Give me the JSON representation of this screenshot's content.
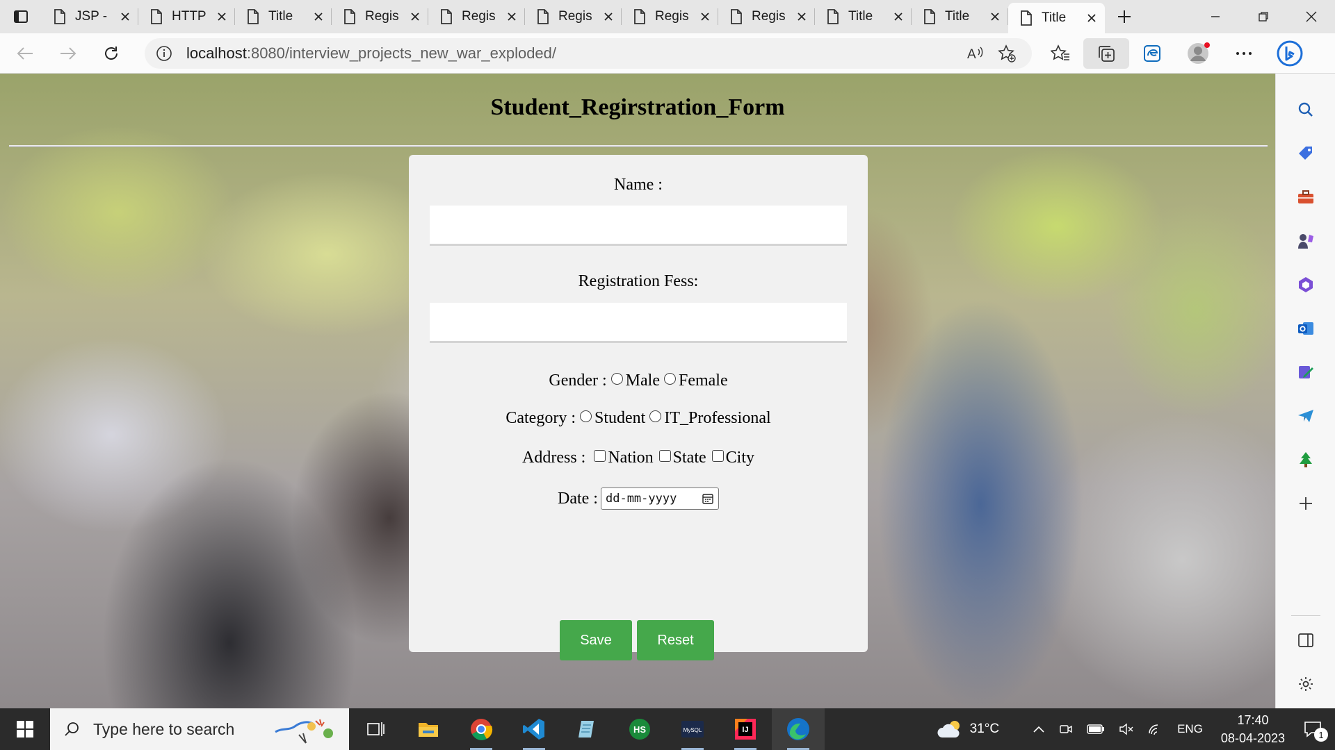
{
  "browser": {
    "tabs": [
      {
        "label": "JSP -",
        "active": false
      },
      {
        "label": "HTTP",
        "active": false
      },
      {
        "label": "Title",
        "active": false
      },
      {
        "label": "Regis",
        "active": false
      },
      {
        "label": "Regis",
        "active": false
      },
      {
        "label": "Regis",
        "active": false
      },
      {
        "label": "Regis",
        "active": false
      },
      {
        "label": "Regis",
        "active": false
      },
      {
        "label": "Title",
        "active": false
      },
      {
        "label": "Title",
        "active": false
      },
      {
        "label": "Title",
        "active": true
      }
    ],
    "address": {
      "host": "localhost",
      "path": ":8080/interview_projects_new_war_exploded/"
    },
    "profile_notification_color": "#e81123"
  },
  "page": {
    "title": "Student_Regirstration_Form",
    "form": {
      "name_label": "Name :",
      "name_value": "",
      "fees_label": "Registration Fess:",
      "fees_value": "",
      "gender": {
        "label": "Gender :",
        "options": [
          "Male",
          "Female"
        ]
      },
      "category": {
        "label": "Category :",
        "options": [
          "Student",
          "IT_Professional"
        ]
      },
      "address": {
        "label": "Address :",
        "options": [
          "Nation",
          "State",
          "City"
        ]
      },
      "date": {
        "label": "Date :",
        "placeholder": "dd-mm-yyyy"
      },
      "save_label": "Save",
      "reset_label": "Reset",
      "button_color": "#45a84b"
    }
  },
  "sidebar": {
    "icons": [
      "search-icon",
      "tag-icon",
      "toolbox-icon",
      "games-icon",
      "office-icon",
      "outlook-icon",
      "designer-icon",
      "telegram-icon",
      "tree-icon",
      "plus-icon",
      "split-view-icon",
      "settings-icon"
    ]
  },
  "taskbar": {
    "search_placeholder": "Type here to search",
    "weather": "31°C",
    "language": "ENG",
    "time": "17:40",
    "date": "08-04-2023",
    "notification_count": "1"
  }
}
